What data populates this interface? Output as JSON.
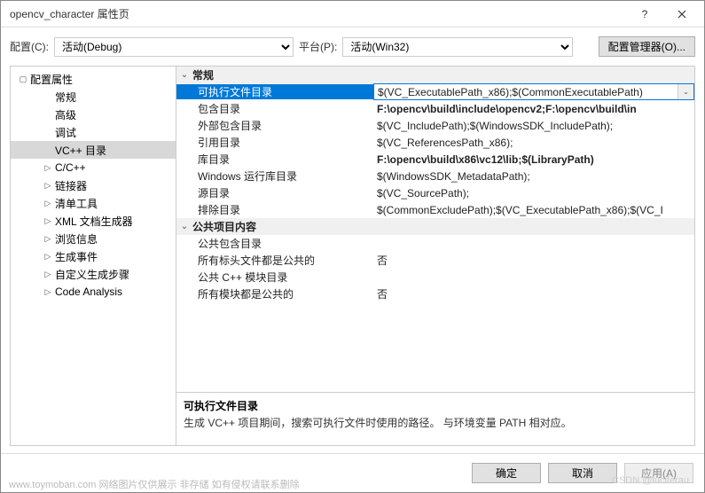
{
  "titlebar": {
    "title": "opencv_character 属性页"
  },
  "config": {
    "config_label": "配置(C):",
    "config_value": "活动(Debug)",
    "platform_label": "平台(P):",
    "platform_value": "活动(Win32)",
    "manager_button": "配置管理器(O)..."
  },
  "tree": {
    "root": "配置属性",
    "items": [
      {
        "label": "常规"
      },
      {
        "label": "高级"
      },
      {
        "label": "调试"
      },
      {
        "label": "VC++ 目录",
        "selected": true
      },
      {
        "label": "C/C++",
        "expandable": true
      },
      {
        "label": "链接器",
        "expandable": true
      },
      {
        "label": "清单工具",
        "expandable": true
      },
      {
        "label": "XML 文档生成器",
        "expandable": true
      },
      {
        "label": "浏览信息",
        "expandable": true
      },
      {
        "label": "生成事件",
        "expandable": true
      },
      {
        "label": "自定义生成步骤",
        "expandable": true
      },
      {
        "label": "Code Analysis",
        "expandable": true
      }
    ]
  },
  "grid": {
    "sections": [
      {
        "header": "常规",
        "rows": [
          {
            "label": "可执行文件目录",
            "value": "$(VC_ExecutablePath_x86);$(CommonExecutablePath)",
            "selected": true
          },
          {
            "label": "包含目录",
            "value": "F:\\opencv\\build\\include\\opencv2;F:\\opencv\\build\\in",
            "bold": true
          },
          {
            "label": "外部包含目录",
            "value": "$(VC_IncludePath);$(WindowsSDK_IncludePath);"
          },
          {
            "label": "引用目录",
            "value": "$(VC_ReferencesPath_x86);"
          },
          {
            "label": "库目录",
            "value": "F:\\opencv\\build\\x86\\vc12\\lib;$(LibraryPath)",
            "bold": true
          },
          {
            "label": "Windows 运行库目录",
            "value": "$(WindowsSDK_MetadataPath);"
          },
          {
            "label": "源目录",
            "value": "$(VC_SourcePath);"
          },
          {
            "label": "排除目录",
            "value": "$(CommonExcludePath);$(VC_ExecutablePath_x86);$(VC_I"
          }
        ]
      },
      {
        "header": "公共项目内容",
        "rows": [
          {
            "label": "公共包含目录",
            "value": ""
          },
          {
            "label": "所有标头文件都是公共的",
            "value": "否"
          },
          {
            "label": "公共 C++ 模块目录",
            "value": ""
          },
          {
            "label": "所有模块都是公共的",
            "value": "否"
          }
        ]
      }
    ]
  },
  "desc": {
    "title": "可执行文件目录",
    "text": "生成 VC++ 项目期间，搜索可执行文件时使用的路径。    与环境变量 PATH 相对应。"
  },
  "footer": {
    "ok": "确定",
    "cancel": "取消",
    "apply": "应用(A)"
  },
  "watermark": "CSDN @luciferau",
  "watermark2": "www.toymoban.com 网络图片仅供展示   非存储   如有侵权请联系删除"
}
